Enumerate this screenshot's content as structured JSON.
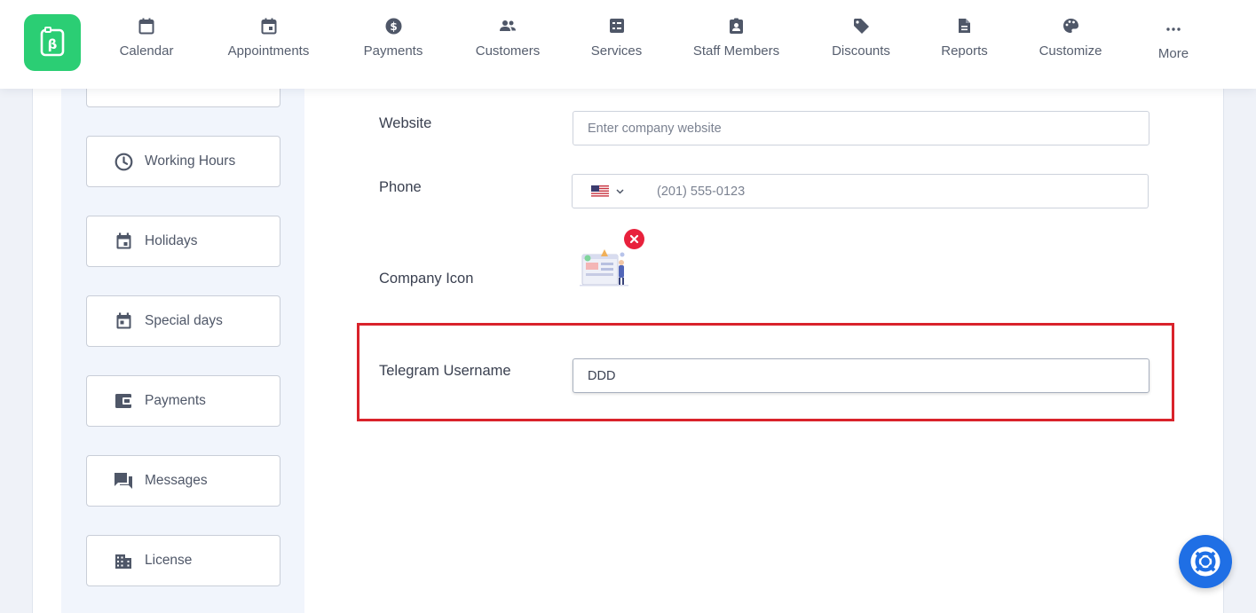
{
  "nav": {
    "items": [
      {
        "label": "Calendar",
        "icon": "calendar-icon"
      },
      {
        "label": "Appointments",
        "icon": "calendar-check-icon"
      },
      {
        "label": "Payments",
        "icon": "dollar-circle-icon"
      },
      {
        "label": "Customers",
        "icon": "people-icon"
      },
      {
        "label": "Services",
        "icon": "list-box-icon"
      },
      {
        "label": "Staff Members",
        "icon": "badge-icon"
      },
      {
        "label": "Discounts",
        "icon": "tag-icon"
      },
      {
        "label": "Reports",
        "icon": "document-icon"
      },
      {
        "label": "Customize",
        "icon": "palette-icon"
      },
      {
        "label": "More",
        "icon": "ellipsis-icon"
      }
    ]
  },
  "sidebar": {
    "items": [
      {
        "label": "Working Hours",
        "icon": "clock-icon"
      },
      {
        "label": "Holidays",
        "icon": "calendar-icon"
      },
      {
        "label": "Special days",
        "icon": "calendar-icon"
      },
      {
        "label": "Payments",
        "icon": "wallet-icon"
      },
      {
        "label": "Messages",
        "icon": "chat-icon"
      },
      {
        "label": "License",
        "icon": "building-icon"
      }
    ]
  },
  "form": {
    "website_label": "Website",
    "website_placeholder": "Enter company website",
    "phone_label": "Phone",
    "phone_placeholder": "(201) 555-0123",
    "company_icon_label": "Company Icon",
    "telegram_label": "Telegram Username",
    "telegram_value": "DDD"
  },
  "colors": {
    "brand": "#2bce74",
    "highlight": "#d9232b",
    "remove": "#e8213c",
    "help": "#1f6fe5"
  }
}
